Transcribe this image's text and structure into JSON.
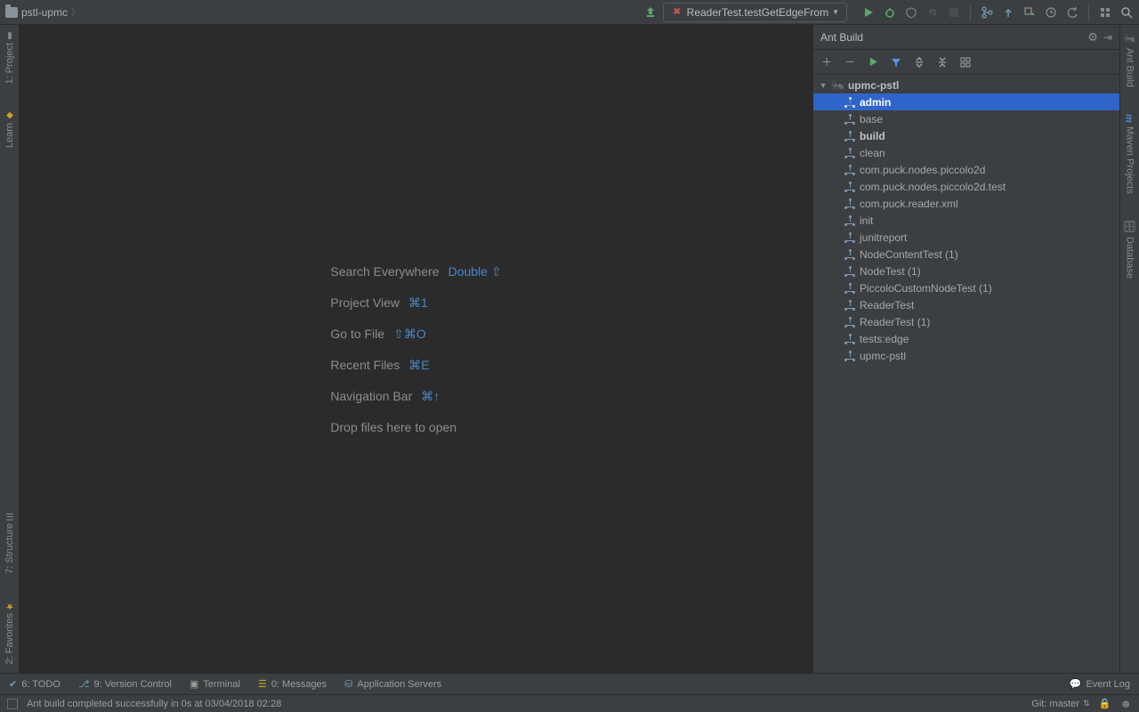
{
  "breadcrumb": {
    "project": "pstl-upmc"
  },
  "run": {
    "config": "ReaderTest.testGetEdgeFrom"
  },
  "left_tabs": {
    "project": "1: Project",
    "learn": "Learn",
    "structure": "7: Structure",
    "favorites": "2: Favorites"
  },
  "right_tabs": {
    "ant": "Ant Build",
    "maven": "Maven Projects",
    "database": "Database"
  },
  "shortcuts": [
    {
      "label": "Search Everywhere",
      "key": "Double ⇧"
    },
    {
      "label": "Project View",
      "key": "⌘1"
    },
    {
      "label": "Go to File",
      "key": "⇧⌘O"
    },
    {
      "label": "Recent Files",
      "key": "⌘E"
    },
    {
      "label": "Navigation Bar",
      "key": "⌘↑"
    },
    {
      "label": "Drop files here to open",
      "key": ""
    }
  ],
  "ant": {
    "title": "Ant Build",
    "root": "upmc-pstl",
    "targets": [
      {
        "label": "admin",
        "selected": true,
        "bold": true
      },
      {
        "label": "base"
      },
      {
        "label": "build",
        "bold": true
      },
      {
        "label": "clean"
      },
      {
        "label": "com.puck.nodes.piccolo2d"
      },
      {
        "label": "com.puck.nodes.piccolo2d.test"
      },
      {
        "label": "com.puck.reader.xml"
      },
      {
        "label": "init"
      },
      {
        "label": "junitreport"
      },
      {
        "label": "NodeContentTest (1)"
      },
      {
        "label": "NodeTest (1)"
      },
      {
        "label": "PiccoloCustomNodeTest (1)"
      },
      {
        "label": "ReaderTest"
      },
      {
        "label": "ReaderTest (1)"
      },
      {
        "label": "tests:edge"
      },
      {
        "label": "upmc-pstl"
      }
    ]
  },
  "bottom": {
    "todo": "6: TODO",
    "vcs": "9: Version Control",
    "terminal": "Terminal",
    "messages": "0: Messages",
    "appservers": "Application Servers",
    "eventlog": "Event Log"
  },
  "status": {
    "message": "Ant build completed successfully in 0s at 03/04/2018 02:28",
    "git": "Git: master"
  }
}
